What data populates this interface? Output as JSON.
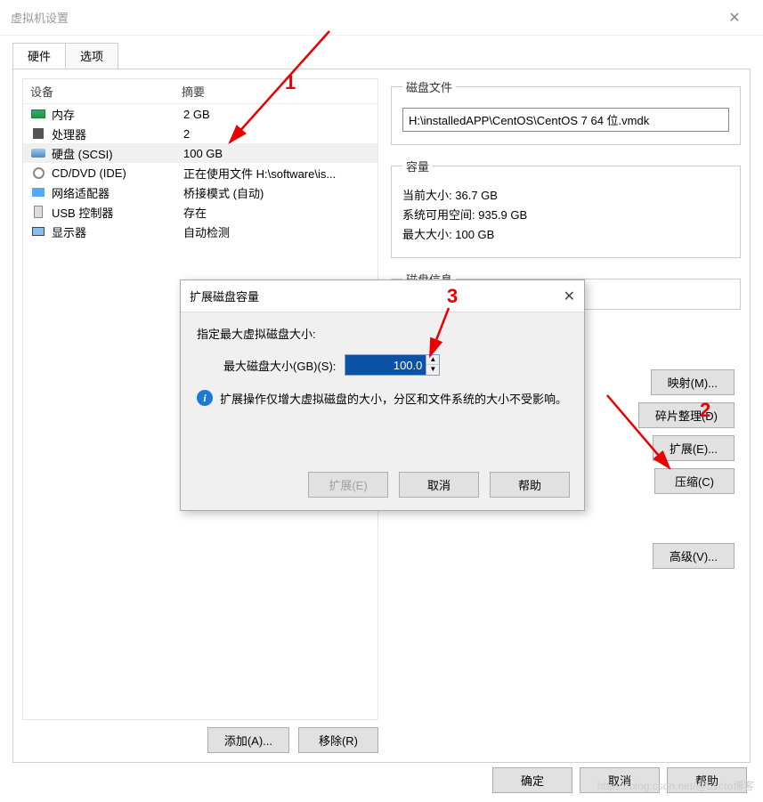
{
  "window": {
    "title": "虚拟机设置"
  },
  "tabs": {
    "hardware": "硬件",
    "options": "选项"
  },
  "hwtable": {
    "head_device": "设备",
    "head_summary": "摘要",
    "rows": [
      {
        "dev": "内存",
        "sum": "2 GB",
        "icon": "ram"
      },
      {
        "dev": "处理器",
        "sum": "2",
        "icon": "cpu"
      },
      {
        "dev": "硬盘 (SCSI)",
        "sum": "100 GB",
        "icon": "hdd",
        "selected": true
      },
      {
        "dev": "CD/DVD (IDE)",
        "sum": "正在使用文件 H:\\software\\is...",
        "icon": "cd"
      },
      {
        "dev": "网络适配器",
        "sum": "桥接模式 (自动)",
        "icon": "net"
      },
      {
        "dev": "USB 控制器",
        "sum": "存在",
        "icon": "usb"
      },
      {
        "dev": "显示器",
        "sum": "自动检测",
        "icon": "disp"
      }
    ],
    "add_btn": "添加(A)...",
    "remove_btn": "移除(R)"
  },
  "detail": {
    "diskfile_legend": "磁盘文件",
    "diskfile_value": "H:\\installedAPP\\CentOS\\CentOS 7 64 位.vmdk",
    "capacity_legend": "容量",
    "cur_label": "当前大小:",
    "cur_val": "36.7 GB",
    "free_label": "系统可用空间:",
    "free_val": "935.9 GB",
    "max_label": "最大大小:",
    "max_val": "100 GB",
    "info_legend": "磁盘信息"
  },
  "util": {
    "map": "映射(M)...",
    "defrag": "碎片整理(D)",
    "expand": "扩展(E)...",
    "compact": "压缩(C)",
    "advanced": "高级(V)..."
  },
  "mainbtns": {
    "ok": "确定",
    "cancel": "取消",
    "help": "帮助"
  },
  "modal": {
    "title": "扩展磁盘容量",
    "prompt": "指定最大虚拟磁盘大小:",
    "field_label": "最大磁盘大小(GB)(S):",
    "field_value": "100.0",
    "info_text": "扩展操作仅增大虚拟磁盘的大小，分区和文件系统的大小不受影响。",
    "btn_expand": "扩展(E)",
    "btn_cancel": "取消",
    "btn_help": "帮助"
  },
  "annotations": {
    "n1": "1",
    "n2": "2",
    "n3": "3"
  }
}
